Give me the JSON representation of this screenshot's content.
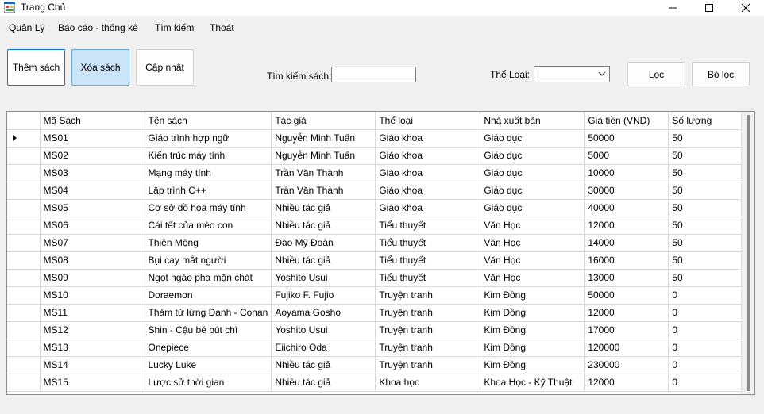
{
  "window": {
    "title": "Trang Chủ",
    "app_icon": "windows-form-icon",
    "controls": [
      "minimize-icon",
      "maximize-icon",
      "close-icon"
    ]
  },
  "menu": [
    {
      "label": "Quản Lý"
    },
    {
      "label": "Báo cáo - thống kê"
    },
    {
      "label": "Tìm kiếm"
    },
    {
      "label": "Thoát"
    }
  ],
  "toolbar": {
    "add_label": "Thêm sách",
    "delete_label": "Xóa sách",
    "update_label": "Cập nhật",
    "search_label": "Tìm kiếm sách:",
    "search_value": "",
    "category_label": "Thể Loại:",
    "category_value": "",
    "filter_label": "Lọc",
    "clear_filter_label": "Bỏ lọc"
  },
  "grid": {
    "columns": [
      "Mã Sách",
      "Tên sách",
      "Tác giả",
      "Thể loại",
      "Nhà xuất bản",
      "Giá tiền (VND)",
      "Số lượng"
    ],
    "current_row_marker": "row-pointer-icon",
    "rows": [
      [
        "MS01",
        "Giáo trình hợp ngữ",
        "Nguyễn Minh Tuấn",
        "Giáo khoa",
        "Giáo dục",
        "50000",
        "50"
      ],
      [
        "MS02",
        "Kiến trúc máy tính",
        "Nguyễn Minh Tuấn",
        "Giáo khoa",
        "Giáo dục",
        "5000",
        "50"
      ],
      [
        "MS03",
        "Mạng máy tính",
        "Trần Văn Thành",
        "Giáo khoa",
        "Giáo dục",
        "10000",
        "50"
      ],
      [
        "MS04",
        "Lập trình C++",
        "Trần Văn Thành",
        "Giáo khoa",
        "Giáo dục",
        "30000",
        "50"
      ],
      [
        "MS05",
        "Cơ sở đồ họa máy tính",
        "Nhiều tác giả",
        "Giáo khoa",
        "Giáo dục",
        "40000",
        "50"
      ],
      [
        "MS06",
        "Cái tết của mèo con",
        "Nhiều tác giả",
        "Tiểu thuyết",
        "Văn Học",
        "12000",
        "50"
      ],
      [
        "MS07",
        "Thiên Mộng",
        "Đào Mỹ Đoàn",
        "Tiểu thuyết",
        "Văn Học",
        "14000",
        "50"
      ],
      [
        "MS08",
        "Bụi cay mắt người",
        "Nhiều tác giả",
        "Tiểu thuyết",
        "Văn Học",
        "16000",
        "50"
      ],
      [
        "MS09",
        "Ngọt ngào pha mặn chát",
        "Yoshito Usui",
        "Tiểu thuyết",
        "Văn Học",
        "13000",
        "50"
      ],
      [
        "MS10",
        "Doraemon",
        "Fujiko F. Fujio",
        "Truyện tranh",
        "Kim Đồng",
        "50000",
        "0"
      ],
      [
        "MS11",
        "Thám tử lừng Danh - Conan",
        "Aoyama Gosho",
        "Truyện tranh",
        "Kim Đồng",
        "12000",
        "0"
      ],
      [
        "MS12",
        "Shin - Cậu bé bút chì",
        "Yoshito Usui",
        "Truyện tranh",
        "Kim Đồng",
        "17000",
        "0"
      ],
      [
        "MS13",
        "Onepiece",
        "Eiichiro Oda",
        "Truyện tranh",
        "Kim Đồng",
        "120000",
        "0"
      ],
      [
        "MS14",
        "Lucky Luke",
        "Nhiều tác giả",
        "Truyện tranh",
        "Kim Đồng",
        "230000",
        "0"
      ],
      [
        "MS15",
        "Lược sử thời gian",
        "Nhiều tác giả",
        "Khoa học",
        "Khoa Học - Kỹ Thuật",
        "12000",
        "0"
      ]
    ]
  }
}
